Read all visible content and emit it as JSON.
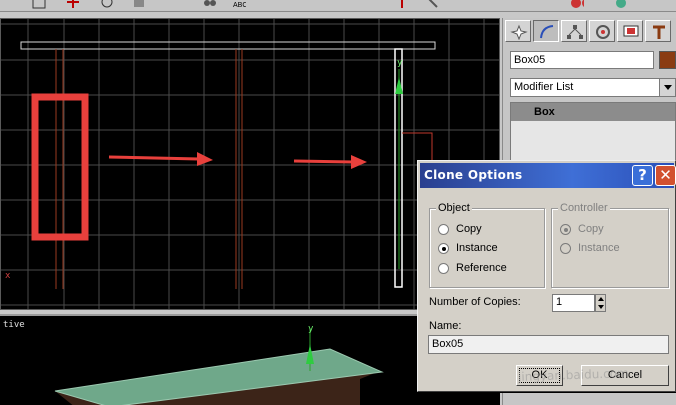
{
  "app": {
    "name": "3ds Max"
  },
  "viewport_top": {
    "axis_x_label": "x",
    "axis_y_label": "y"
  },
  "viewport_persp": {
    "label": "tive",
    "axis_y_label": "y"
  },
  "command_panel": {
    "tabs": [
      {
        "icon": "create-icon"
      },
      {
        "icon": "modify-icon"
      },
      {
        "icon": "hierarchy-icon"
      },
      {
        "icon": "motion-icon"
      },
      {
        "icon": "display-icon"
      },
      {
        "icon": "utilities-icon"
      }
    ],
    "object_name": "Box05",
    "object_color": "#8a3b12",
    "modifier_list_label": "Modifier List",
    "stack_items": [
      "Box"
    ]
  },
  "dialog": {
    "title": "Clone Options",
    "help_glyph": "?",
    "close_glyph": "✕",
    "object_group": {
      "legend": "Object",
      "options": [
        "Copy",
        "Instance",
        "Reference"
      ],
      "selected": "Instance"
    },
    "controller_group": {
      "legend": "Controller",
      "options": [
        "Copy",
        "Instance"
      ],
      "selected": "Copy",
      "disabled": true
    },
    "copies_label": "Number of Copies:",
    "copies_value": "1",
    "name_label": "Name:",
    "name_value": "Box05",
    "ok_label": "OK",
    "cancel_label": "Cancel"
  },
  "annotation_color": "#e8403c",
  "watermark_text": "jingyan.baidu.com"
}
